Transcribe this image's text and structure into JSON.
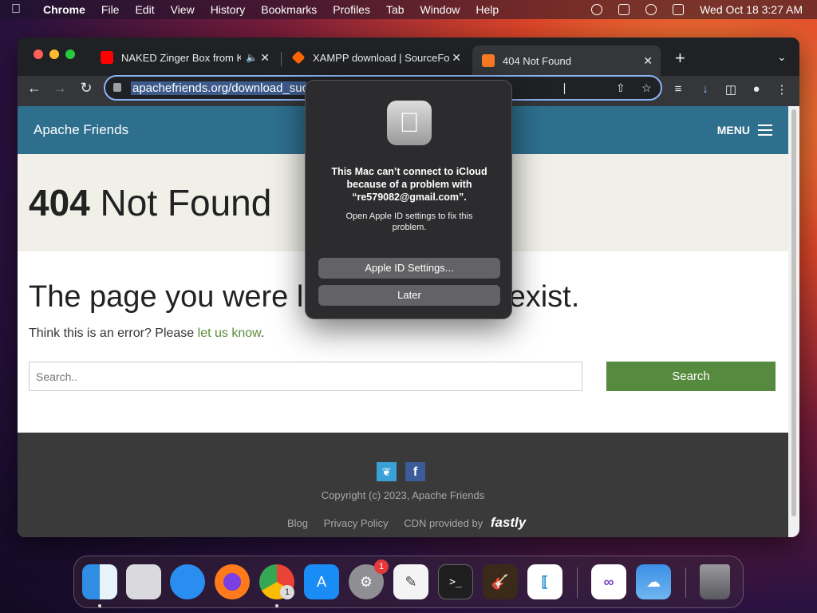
{
  "menubar": {
    "app_name": "Chrome",
    "items": [
      "File",
      "Edit",
      "View",
      "History",
      "Bookmarks",
      "Profiles",
      "Tab",
      "Window",
      "Help"
    ],
    "clock": "Wed Oct 18  3:27 AM"
  },
  "tabs": [
    {
      "title": "NAKED Zinger Box from KFC",
      "icon": "youtube-icon",
      "color": "#ff0000"
    },
    {
      "title": "XAMPP download | SourceForge",
      "icon": "sourceforge-icon",
      "color": "#ff6600"
    },
    {
      "title": "404 Not Found",
      "icon": "xampp-icon",
      "color": "#fb7a24"
    }
  ],
  "omnibox": {
    "url": "apachefriends.org/download_suc"
  },
  "site": {
    "brand": "Apache Friends",
    "menu_label": "MENU",
    "heading_code": "404",
    "heading_text": " Not Found",
    "lead_left": "The page you were loo",
    "lead_right": "exist.",
    "error_text": "Think this is an error? Please ",
    "error_link": "let us know",
    "error_end": ".",
    "search_placeholder": "Search..",
    "search_button": "Search"
  },
  "footer": {
    "copyright": "Copyright (c) 2023, Apache Friends",
    "links": [
      "Blog",
      "Privacy Policy",
      "CDN provided by"
    ],
    "cdn_brand": "fastly"
  },
  "dialog": {
    "title": "This Mac can’t connect to iCloud because of a problem with “re579082@gmail.com”.",
    "message": "Open Apple ID settings to fix this problem.",
    "primary_button": "Apple ID Settings...",
    "secondary_button": "Later"
  },
  "dock": {
    "apps": [
      "Finder",
      "Launchpad",
      "Safari",
      "Firefox",
      "Chrome",
      "App Store",
      "System Settings",
      "TextEdit",
      "Terminal",
      "GarageBand",
      "VS Code",
      "Visual Studio",
      "Weather",
      "Trash"
    ],
    "settings_badge": "1",
    "chrome_badge": "1"
  },
  "colors": {
    "accent": "#8ab4f8",
    "header": "#2e6f8e",
    "search_button": "#568a3e"
  }
}
